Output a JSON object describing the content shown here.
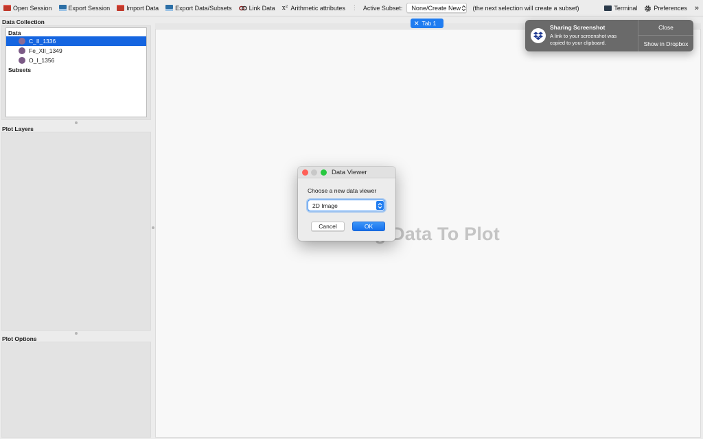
{
  "toolbar": {
    "open_session": "Open Session",
    "export_session": "Export Session",
    "import_data": "Import Data",
    "export_data_subsets": "Export Data/Subsets",
    "link_data": "Link Data",
    "arith_icon": "x²",
    "arithmetic_attributes": "Arithmetic attributes",
    "active_subset_label": "Active Subset:",
    "active_subset_value": "None/Create New",
    "subset_hint": "(the next selection will create a subset)",
    "terminal": "Terminal",
    "preferences": "Preferences",
    "overflow": "»"
  },
  "left_panel": {
    "data_collection_title": "Data Collection",
    "tree_header": "Data",
    "data_items": [
      {
        "label": "C_II_1336",
        "selected": true
      },
      {
        "label": "Fe_XII_1349",
        "selected": false
      },
      {
        "label": "O_I_1356",
        "selected": false
      }
    ],
    "subsets_header": "Subsets",
    "plot_layers_title": "Plot Layers",
    "plot_options_title": "Plot Options"
  },
  "main": {
    "tab_close": "✕",
    "tab_label": "Tab 1",
    "drop_hint": "Drag Data To Plot"
  },
  "dialog": {
    "title": "Data Viewer",
    "prompt": "Choose a new data viewer",
    "selected_viewer": "2D Image",
    "cancel_label": "Cancel",
    "ok_label": "OK"
  },
  "notification": {
    "title": "Sharing Screenshot",
    "body": "A link to your screenshot was copied to your clipboard.",
    "close_label": "Close",
    "show_label": "Show in Dropbox"
  },
  "colors": {
    "accent": "#1f7cf0",
    "selection": "#1565e0",
    "data_dot": "#7b5a86",
    "notification_bg": "#6a6a6a"
  },
  "icons": [
    "folder-icon",
    "save-icon",
    "link-icon",
    "terminal-icon",
    "gear-icon",
    "dropbox-icon",
    "chevron-updown-icon"
  ]
}
